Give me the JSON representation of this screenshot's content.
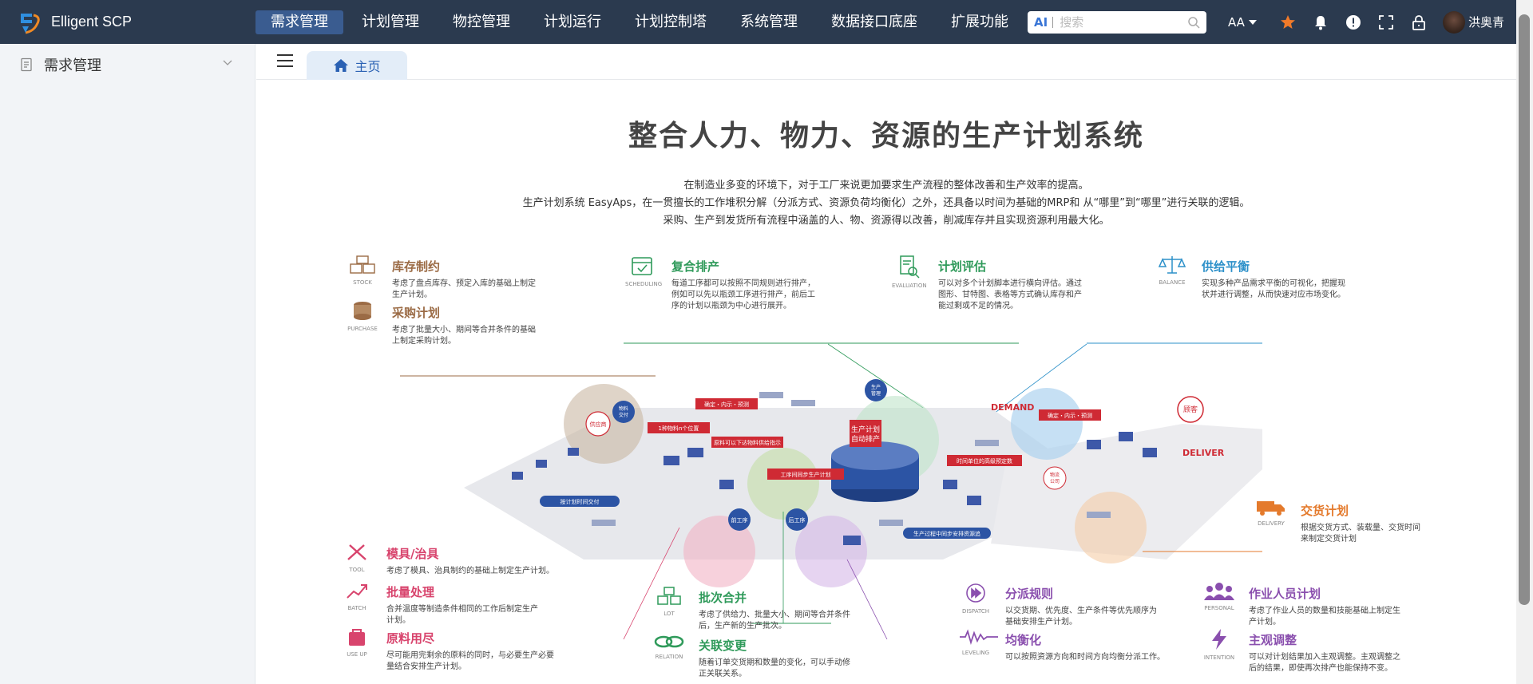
{
  "app": {
    "brand": "Elligent SCP"
  },
  "nav": {
    "items": [
      "需求管理",
      "计划管理",
      "物控管理",
      "计划运行",
      "计划控制塔",
      "系统管理",
      "数据接口底座",
      "扩展功能"
    ],
    "active": 0
  },
  "search": {
    "ai_label": "AI",
    "placeholder": "搜索"
  },
  "tools": {
    "font_label": "AA"
  },
  "user": {
    "name": "洪奥青"
  },
  "sidebar": {
    "items": [
      {
        "label": "需求管理"
      }
    ]
  },
  "tabs": [
    {
      "label": "主页"
    }
  ],
  "poster": {
    "headline": "整合人力、物力、资源的生产计划系统",
    "intro": [
      "在制造业多变的环境下，对于工厂来说更加要求生产流程的整体改善和生产效率的提高。",
      "生产计划系统 EasyAps，在一贯擅长的工作堆积分解（分派方式、资源负荷均衡化）之外，还具备以时间为基础的MRP和 从“哪里”到“哪里”进行关联的逻辑。",
      "采购、生产到发货所有流程中涵盖的人、物、资源得以改善，削减库存并且实现资源利用最大化。"
    ],
    "features": [
      {
        "title": "库存制约",
        "en": "STOCK",
        "desc": "考虑了盘点库存、预定入库的基础上制定\n生产计划。",
        "color": "#9b6b45"
      },
      {
        "title": "采购计划",
        "en": "PURCHASE",
        "desc": "考虑了批量大小、期间等合并条件的基础\n上制定采购计划。",
        "color": "#9b6b45"
      },
      {
        "title": "复合排产",
        "en": "SCHEDULING",
        "desc": "每道工序都可以按照不同规则进行排产，\n例如可以先以瓶颈工序进行排产，前后工\n序的计划以瓶颈为中心进行展开。",
        "color": "#2f9a5a"
      },
      {
        "title": "计划评估",
        "en": "EVALUATION",
        "desc": "可以对多个计划脚本进行横向评估。通过\n图形、甘特图、表格等方式确认库存和产\n能过剩或不足的情况。",
        "color": "#2f9a5a"
      },
      {
        "title": "供给平衡",
        "en": "BALANCE",
        "desc": "实现多种产品需求平衡的可视化，把握现\n状并进行调整，从而快速对应市场变化。",
        "color": "#2c90c9"
      },
      {
        "title": "交货计划",
        "en": "DELIVERY",
        "desc": "根据交货方式、装载量、交货时间\n来制定交货计划",
        "color": "#e47a2c"
      },
      {
        "title": "模具/治具",
        "en": "TOOL",
        "desc": "考虑了模具、治具制约的基础上制定生产计划。",
        "color": "#d8446d"
      },
      {
        "title": "批量处理",
        "en": "BATCH",
        "desc": "合并温度等制造条件相同的工作后制定生产\n计划。",
        "color": "#d8446d"
      },
      {
        "title": "原料用尽",
        "en": "USE UP",
        "desc": "尽可能用完剩余的原料的同时，与必要生产必要\n量结合安排生产计划。",
        "color": "#d8446d"
      },
      {
        "title": "批次合并",
        "en": "LOT",
        "desc": "考虑了供给力、批量大小、期间等合并条件\n后，生产新的生产批次。",
        "color": "#2f9a5a"
      },
      {
        "title": "关联变更",
        "en": "RELATION",
        "desc": "随着订单交货期和数量的变化，可以手动修\n正关联关系。",
        "color": "#2f9a5a"
      },
      {
        "title": "分派规则",
        "en": "DISPATCH",
        "desc": "以交货期、优先度、生产条件等优先顺序为\n基础安排生产计划。",
        "color": "#8a4fae"
      },
      {
        "title": "均衡化",
        "en": "LEVELING",
        "desc": "可以按照资源方向和时间方向均衡分派工作。",
        "color": "#8a4fae"
      },
      {
        "title": "作业人员计划",
        "en": "PERSONAL",
        "desc": "考虑了作业人员的数量和技能基础上制定生\n产计划。",
        "color": "#8a4fae"
      },
      {
        "title": "主观调整",
        "en": "INTENTION",
        "desc": "可以对计划结果加入主观调整。主观调整之\n后的结果，即使再次排产也能保持不变。",
        "color": "#8a4fae"
      }
    ],
    "illustration_labels": {
      "demand": "DEMAND",
      "deliver": "DELIVER",
      "customer": "顾客",
      "supplier": "供应商",
      "center": "生产计划\n自动排产",
      "tags": [
        "确定・内示・预测",
        "1种物料n个位置",
        "原料可以下达物料供给指示",
        "工序间同步生产计划",
        "确定・内示・预测",
        "时间单位的高级预定数",
        "生产过程中同步安排资源追",
        "按计划时间交付",
        "前工序",
        "后工序",
        "物料交付",
        "生产管理",
        "均衡化",
        "物流公司"
      ]
    }
  }
}
